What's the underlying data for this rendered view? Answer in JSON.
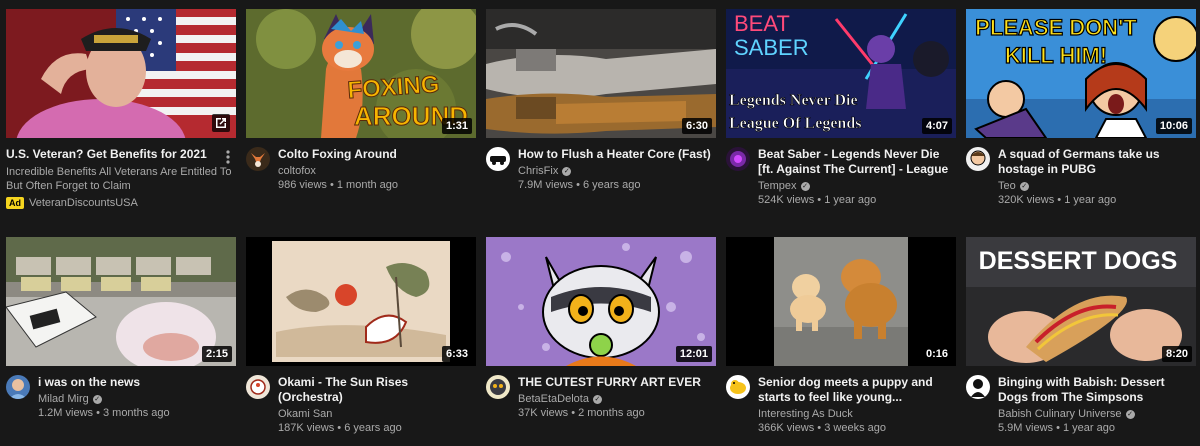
{
  "videos": [
    {
      "title": "U.S. Veteran? Get Benefits for 2021",
      "description": "Incredible Benefits All Veterans Are Entitled To But Often Forget to Claim",
      "ad_label": "Ad",
      "advertiser": "VeteranDiscountsUSA",
      "icon": "external-link-icon"
    },
    {
      "title": "Colto Foxing Around",
      "channel": "coltofox",
      "stats": "986 views • 1 month ago",
      "duration": "1:31",
      "thumb_text_1": "FOXING",
      "thumb_text_2": "AROUND"
    },
    {
      "title": "How to Flush a Heater Core (Fast)",
      "channel": "ChrisFix",
      "stats": "7.9M views • 6 years ago",
      "duration": "6:30",
      "verified": true
    },
    {
      "title": "Beat Saber - Legends Never Die [ft. Against The Current] - League Of...",
      "channel": "Tempex",
      "stats": "524K views • 1 year ago",
      "duration": "4:07",
      "verified": true,
      "thumb_text_1": "BEAT",
      "thumb_text_2": "SABER",
      "thumb_text_3": "Legends Never Die",
      "thumb_text_4": "League Of Legends"
    },
    {
      "title": "A squad of Germans take us hostage in PUBG",
      "channel": "Teo",
      "stats": "320K views • 1 year ago",
      "duration": "10:06",
      "verified": true,
      "thumb_text_1": "PLEASE DON'T",
      "thumb_text_2": "KILL HIM!"
    },
    {
      "title": "i was on the news",
      "channel": "Milad Mirg",
      "stats": "1.2M views • 3 months ago",
      "duration": "2:15",
      "verified": true
    },
    {
      "title": "Okami - The Sun Rises (Orchestra)",
      "channel": "Okami San",
      "stats": "187K views • 6 years ago",
      "duration": "6:33"
    },
    {
      "title": "THE CUTEST FURRY ART EVER",
      "channel": "BetaEtaDelota",
      "stats": "37K views • 2 months ago",
      "duration": "12:01",
      "verified": true
    },
    {
      "title": "Senior dog meets a puppy and starts to feel like young...",
      "channel": "Interesting As Duck",
      "stats": "366K views • 3 weeks ago",
      "duration": "0:16"
    },
    {
      "title": "Binging with Babish: Dessert Dogs from The Simpsons",
      "channel": "Babish Culinary Universe",
      "stats": "5.9M views • 1 year ago",
      "duration": "8:20",
      "verified": true,
      "thumb_text_1": "DESSERT DOGS"
    }
  ],
  "verified_mark": "✓",
  "colors": {
    "background": "#181818",
    "title": "#f1f1f1",
    "meta": "#aaaaaa",
    "ad_badge": "#f6d51f"
  }
}
